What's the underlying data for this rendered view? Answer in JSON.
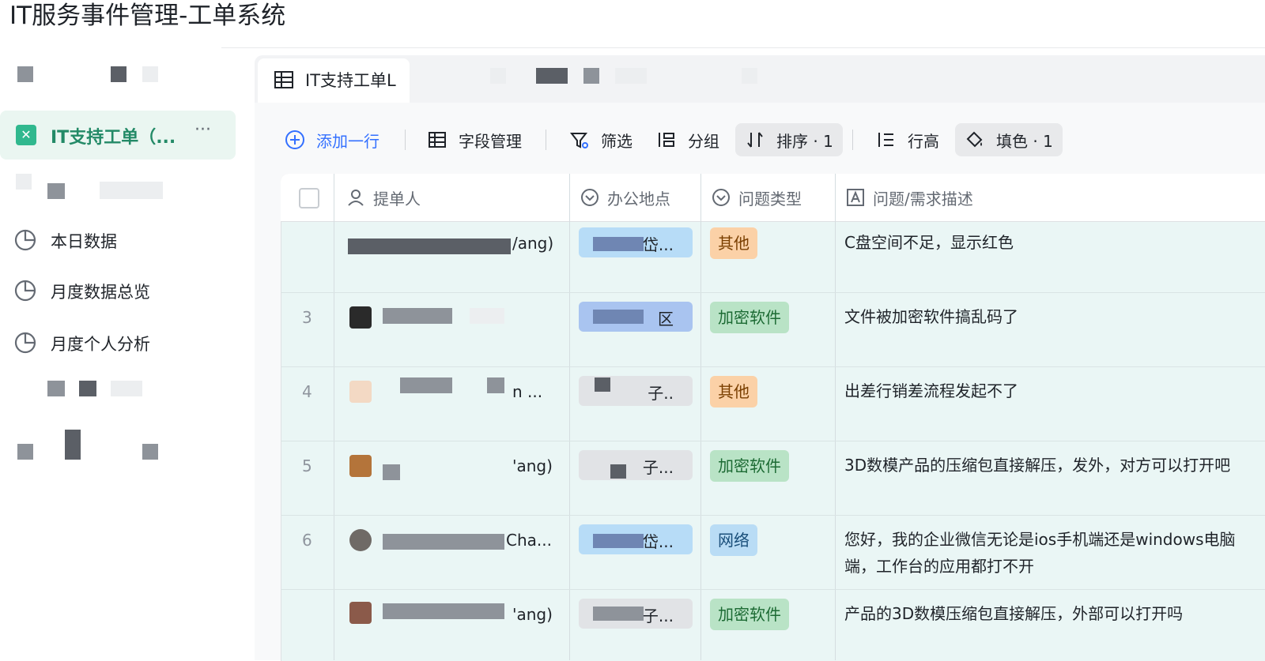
{
  "app": {
    "title": "IT服务事件管理-工单系统"
  },
  "sidebar": {
    "active": {
      "label": "IT支持工单（...",
      "more": "···"
    },
    "items": [
      {
        "label": "本日数据",
        "icon": "pie-chart-icon"
      },
      {
        "label": "月度数据总览",
        "icon": "pie-chart-icon"
      },
      {
        "label": "月度个人分析",
        "icon": "pie-chart-icon"
      }
    ]
  },
  "tab": {
    "label": "IT支持工单L"
  },
  "toolbar": {
    "add_row": "添加一行",
    "fields": "字段管理",
    "filter": "筛选",
    "group": "分组",
    "sort": "排序 · 1",
    "row_height": "行高",
    "fill": "填色 · 1"
  },
  "columns": {
    "submitter": "提单人",
    "location": "办公地点",
    "issue_type": "问题类型",
    "description": "问题/需求描述"
  },
  "rows": [
    {
      "num": "",
      "name_tail": "/ang)",
      "location_tail": "岱...",
      "location_color": "blue",
      "type": "其他",
      "type_kind": "other",
      "desc": "C盘空间不足，显示红色"
    },
    {
      "num": "3",
      "name_tail": "",
      "location_tail": "区",
      "location_color": "blue",
      "type": "加密软件",
      "type_kind": "enc",
      "desc": "文件被加密软件搞乱码了"
    },
    {
      "num": "4",
      "name_tail": "n ...",
      "location_tail": "子..",
      "location_color": "grey",
      "type": "其他",
      "type_kind": "other",
      "desc": "出差行销差流程发起不了"
    },
    {
      "num": "5",
      "name_tail": "'ang)",
      "location_tail": "子...",
      "location_color": "grey",
      "type": "加密软件",
      "type_kind": "enc",
      "desc": "3D数模产品的压缩包直接解压，发外，对方可以打开吧"
    },
    {
      "num": "6",
      "name_tail": "Cha...",
      "location_tail": "岱...",
      "location_color": "blue",
      "type": "网络",
      "type_kind": "net",
      "desc": "您好，我的企业微信无论是ios手机端还是windows电脑端，工作台的应用都打不开"
    },
    {
      "num": "",
      "name_tail": "'ang)",
      "location_tail": "子...",
      "location_color": "grey",
      "type": "加密软件",
      "type_kind": "enc",
      "desc": "产品的3D数模压缩包直接解压，外部可以打开吗"
    }
  ]
}
